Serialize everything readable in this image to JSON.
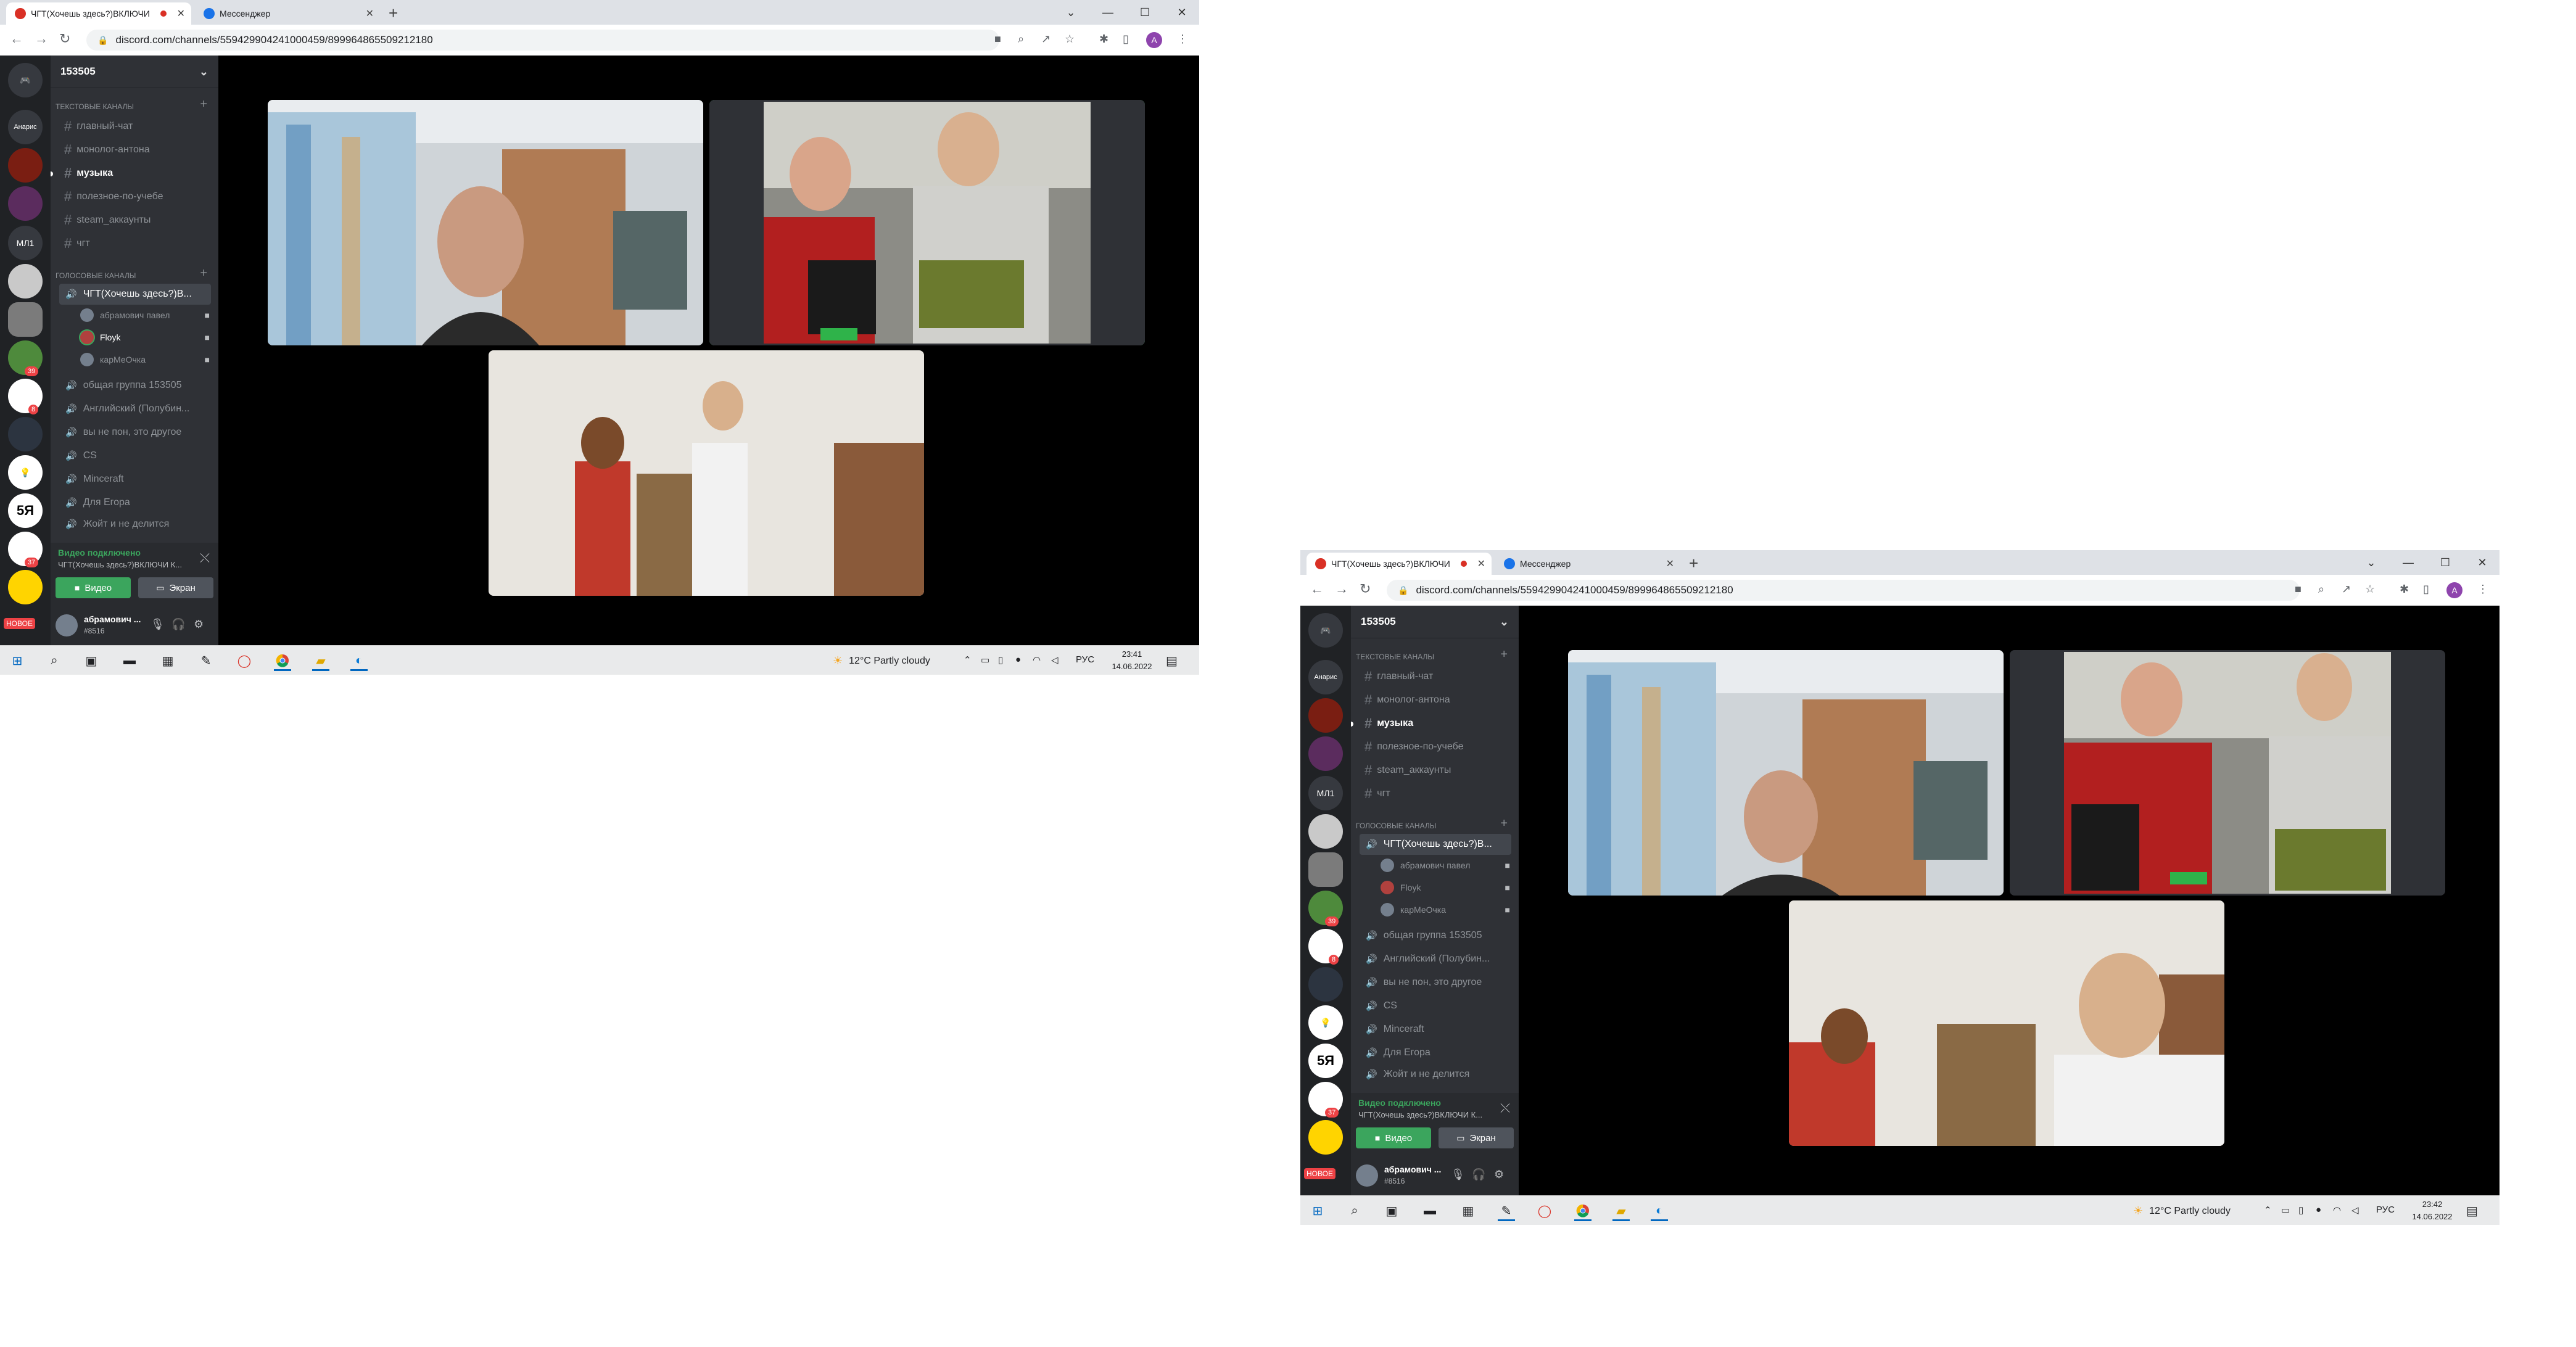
{
  "tabs": [
    {
      "title": "ЧГТ(Хочешь здесь?)ВКЛЮЧИ",
      "close": "✕"
    },
    {
      "title": "Мессенджер",
      "close": "✕"
    }
  ],
  "new_tab": "+",
  "window_controls": {
    "tab_search": "⌄",
    "minimize": "—",
    "maximize": "☐",
    "close": "✕"
  },
  "nav": {
    "back": "←",
    "forward": "→",
    "reload": "↻"
  },
  "url": "discord.com/channels/559429904241000459/899964865509212180",
  "profile_initial": "A",
  "server": {
    "name": "153505",
    "chevron": "⌄"
  },
  "guilds": [
    {
      "label": "Анарис",
      "color": "#36393f"
    },
    {
      "label": "",
      "color": "#7a1e12"
    },
    {
      "label": "",
      "color": "#5b2c5e"
    },
    {
      "label": "МЛ1",
      "color": "#36393f"
    },
    {
      "label": "",
      "color": "#c9c9c9"
    },
    {
      "label": "",
      "color": "#7b7b7b"
    },
    {
      "label": "",
      "color": "#4e8a3c"
    },
    {
      "label": "",
      "color": "#ffffff"
    },
    {
      "label": "",
      "color": "#2c3440"
    },
    {
      "label": "💡",
      "color": "#ffffff"
    },
    {
      "label": "5Я",
      "color": "#ffffff"
    },
    {
      "label": "",
      "color": "#ffffff"
    },
    {
      "label": "",
      "color": "#ffd400"
    }
  ],
  "guild_badges": {
    "b1": "39",
    "b2": "8",
    "b3": "37"
  },
  "guild_new": "НОВОЕ",
  "categories": {
    "text": "ТЕКСТОВЫЕ КАНАЛЫ",
    "voice": "ГОЛОСОВЫЕ КАНАЛЫ",
    "plus": "+"
  },
  "text_channels": [
    "главный-чат",
    "монолог-антона",
    "музыка",
    "полезное-по-учебе",
    "steam_аккаунты",
    "чгт"
  ],
  "voice_selected": "ЧГТ(Хочешь здесь?)В...",
  "members": [
    {
      "name": "абрамович павел",
      "color": "#747f8d"
    },
    {
      "name": "Floyk",
      "color": "#b0413e"
    },
    {
      "name": "карМеОчка",
      "color": "#747f8d"
    }
  ],
  "voice_channels": [
    "общая группа 153505",
    "Английский (Полубин...",
    "вы не пон, это другое",
    "CS",
    "Minceraft",
    "Для Егора",
    "Жойт и не делится"
  ],
  "voice_panel": {
    "status": "Видео подключено",
    "channel": "ЧГТ(Хочешь здесь?)ВКЛЮЧИ К...",
    "disconnect": "⤬",
    "video": "Видео",
    "screen": "Экран"
  },
  "user": {
    "name": "абрамович ...",
    "tag": "#8516",
    "mic": "🎙",
    "headset": "🎧",
    "settings": "⚙"
  },
  "taskbar": {
    "weather": "12°C  Partly cloudy",
    "lang": "РУС",
    "shot1_time": "23:41",
    "shot2_time": "23:42",
    "date": "14.06.2022"
  },
  "icons": {
    "search": "⌕",
    "hash": "#",
    "speaker": "🔊"
  }
}
